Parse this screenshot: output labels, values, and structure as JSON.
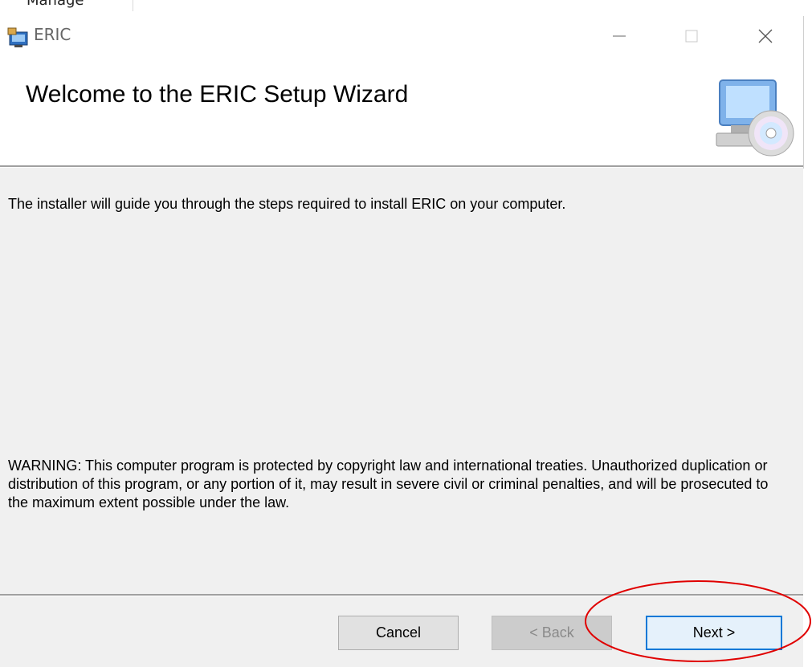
{
  "background": {
    "partial_text": "Manage"
  },
  "window": {
    "title": "ERIC",
    "controls": {
      "minimize": "—",
      "close": "✕"
    }
  },
  "header": {
    "title": "Welcome to the ERIC Setup Wizard"
  },
  "body": {
    "intro": "The installer will guide you through the steps required to install ERIC on your computer.",
    "warning": "WARNING: This computer program is protected by copyright law and international treaties. Unauthorized duplication or distribution of this program, or any portion of it, may result in severe civil or criminal penalties, and will be prosecuted to the maximum extent possible under the law."
  },
  "buttons": {
    "cancel": "Cancel",
    "back": "< Back",
    "next": "Next >"
  },
  "colors": {
    "accent": "#0078d7",
    "annotation": "#e00000",
    "dialog_bg": "#f0f0f0"
  }
}
